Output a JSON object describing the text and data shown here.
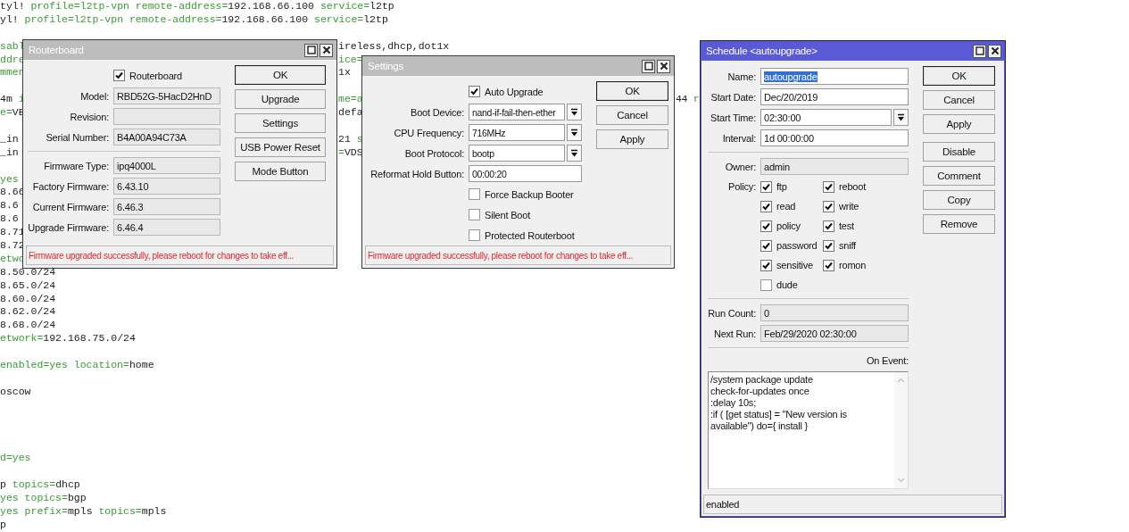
{
  "console": {
    "lines": [
      {
        "left": [
          {
            "text": "tyl! ",
            "kind": "value"
          },
          {
            "text": "profile=l2tp-vpn remote-address=",
            "kind": "key"
          },
          {
            "text": "192.168.66.100 ",
            "kind": "value"
          },
          {
            "text": "service=",
            "kind": "key"
          },
          {
            "text": "l2tp",
            "kind": "value"
          }
        ]
      },
      {
        "left": [
          {
            "text": "yl! ",
            "kind": "value"
          },
          {
            "text": "profile=l2tp-vpn remote-address=",
            "kind": "key"
          },
          {
            "text": "192.168.66.100 ",
            "kind": "value"
          },
          {
            "text": "service=",
            "kind": "key"
          },
          {
            "text": "l2tp",
            "kind": "value"
          }
        ]
      },
      {
        "kind": "spaced",
        "left": [
          {
            "text": "sabl",
            "kind": "key"
          }
        ],
        "middle": [
          {
            "text": "ireless,dhcp,dot1x",
            "kind": "value"
          }
        ]
      },
      {
        "left": [
          {
            "text": "ddre",
            "kind": "key"
          }
        ],
        "middle": [
          {
            "text": "ice=",
            "kind": "key"
          }
        ]
      },
      {
        "left": [
          {
            "text": "mmen",
            "kind": "key"
          }
        ],
        "middle": [
          {
            "text": "1x",
            "kind": "value"
          }
        ]
      },
      {
        "kind": "spaced",
        "left": [
          {
            "text": "4m ",
            "kind": "value"
          },
          {
            "text": "i",
            "kind": "key"
          }
        ],
        "middle": [
          {
            "text": "me=a",
            "kind": "key"
          }
        ],
        "right": [
          {
            "text": "44 ",
            "kind": "value"
          },
          {
            "text": "r",
            "kind": "key"
          }
        ]
      },
      {
        "left": [
          {
            "text": "e=",
            "kind": "key"
          },
          {
            "text": "VE",
            "kind": "value"
          }
        ],
        "middle": [
          {
            "text": "defa",
            "kind": "value"
          }
        ]
      },
      {
        "kind": "spaced",
        "left": [
          {
            "text": "_in",
            "kind": "value"
          }
        ],
        "middle": [
          {
            "text": "21 ",
            "kind": "value"
          },
          {
            "text": "s",
            "kind": "key"
          }
        ]
      },
      {
        "left": [
          {
            "text": "_in",
            "kind": "value"
          }
        ],
        "middle": [
          {
            "text": "=",
            "kind": "key"
          },
          {
            "text": "VDS",
            "kind": "value"
          }
        ]
      },
      {
        "kind": "spaced",
        "left": [
          {
            "text": "yes",
            "kind": "key"
          }
        ]
      },
      {
        "left": [
          {
            "text": "8.66",
            "kind": "value"
          }
        ]
      },
      {
        "left": [
          {
            "text": "8.6",
            "kind": "value"
          }
        ]
      },
      {
        "left": [
          {
            "text": "8.6",
            "kind": "value"
          }
        ]
      },
      {
        "left": [
          {
            "text": "8.71",
            "kind": "value"
          }
        ]
      },
      {
        "left": [
          {
            "text": "8.72",
            "kind": "value"
          }
        ]
      },
      {
        "left": [
          {
            "text": "etwo",
            "kind": "key"
          }
        ]
      },
      {
        "left": [
          {
            "text": "8.50.0/24",
            "kind": "value"
          }
        ]
      },
      {
        "left": [
          {
            "text": "8.65.0/24",
            "kind": "value"
          }
        ]
      },
      {
        "left": [
          {
            "text": "8.60.0/24",
            "kind": "value"
          }
        ]
      },
      {
        "left": [
          {
            "text": "8.62.0/24",
            "kind": "value"
          }
        ]
      },
      {
        "left": [
          {
            "text": "8.68.0/24",
            "kind": "value"
          }
        ]
      },
      {
        "left": [
          {
            "text": "etwork=",
            "kind": "key"
          },
          {
            "text": "192.168.75.0/24",
            "kind": "value"
          }
        ]
      },
      {
        "kind": "spaced",
        "left": [
          {
            "text": "enabled=yes location=",
            "kind": "key"
          },
          {
            "text": "home",
            "kind": "value"
          }
        ]
      },
      {
        "kind": "spaced",
        "left": [
          {
            "text": "oscow",
            "kind": "value"
          }
        ]
      },
      {
        "kind": "gapped",
        "left": [
          {
            "text": "d=yes",
            "kind": "key"
          }
        ]
      },
      {
        "kind": "spaced",
        "left": [
          {
            "text": "p ",
            "kind": "value"
          },
          {
            "text": "topics=",
            "kind": "key"
          },
          {
            "text": "dhcp",
            "kind": "value"
          }
        ]
      },
      {
        "left": [
          {
            "text": "yes topics=",
            "kind": "key"
          },
          {
            "text": "bgp",
            "kind": "value"
          }
        ]
      },
      {
        "left": [
          {
            "text": "yes prefix=",
            "kind": "key"
          },
          {
            "text": "mpls ",
            "kind": "value"
          },
          {
            "text": "topics=",
            "kind": "key"
          },
          {
            "text": "mpls",
            "kind": "value"
          }
        ]
      },
      {
        "left": [
          {
            "text": "p",
            "kind": "value"
          }
        ]
      }
    ]
  },
  "windows": [
    {
      "kind": "routerboard",
      "title": "Routerboard",
      "active": false,
      "rows": [
        {
          "kind": "checkbox",
          "label": "Routerboard",
          "checked": true
        },
        {
          "kind": "field",
          "label": "Model:",
          "value": "RBD52G-5HacD2HnD",
          "editable": false
        },
        {
          "kind": "field",
          "label": "Revision:",
          "editable": false
        },
        {
          "kind": "field",
          "label": "Serial Number:",
          "value": "B4A00A94C73A",
          "editable": false
        },
        {
          "kind": "separator"
        },
        {
          "kind": "field",
          "label": "Firmware Type:",
          "value": "ipq4000L",
          "editable": false
        },
        {
          "kind": "field",
          "label": "Factory Firmware:",
          "value": "6.43.10",
          "editable": false
        },
        {
          "kind": "field",
          "label": "Current Firmware:",
          "value": "6.46.3",
          "editable": false
        },
        {
          "kind": "field",
          "label": "Upgrade Firmware:",
          "value": "6.46.4",
          "editable": false
        }
      ],
      "buttons": [
        {
          "label": "OK",
          "default": true
        },
        {
          "label": "Upgrade"
        },
        {
          "label": "Settings"
        },
        {
          "label": "USB Power Reset"
        },
        {
          "label": "Mode Button"
        }
      ],
      "status": "Firmware upgraded successfully, please reboot for changes to take eff...",
      "status_error": true
    },
    {
      "kind": "settings",
      "title": "Settings",
      "active": false,
      "rows": [
        {
          "kind": "checkbox",
          "label": "Auto Upgrade",
          "checked": true
        },
        {
          "kind": "field",
          "label": "Boot Device:",
          "value": "nand-if-fail-then-ether",
          "editable": true,
          "dropdown": true
        },
        {
          "kind": "field",
          "label": "CPU Frequency:",
          "value": "716MHz",
          "editable": true,
          "dropdown": true
        },
        {
          "kind": "field",
          "label": "Boot Protocol:",
          "value": "bootp",
          "editable": true,
          "dropdown": true
        },
        {
          "kind": "field",
          "label": "Reformat Hold Button:",
          "value": "00:00:20",
          "editable": true
        },
        {
          "kind": "checkbox",
          "label": "Force Backup Booter",
          "checked": false
        },
        {
          "kind": "checkbox",
          "label": "Silent Boot",
          "checked": false
        },
        {
          "kind": "checkbox",
          "label": "Protected Routerboot",
          "checked": false
        }
      ],
      "buttons": [
        {
          "label": "OK",
          "default": true
        },
        {
          "label": "Cancel"
        },
        {
          "label": "Apply"
        }
      ],
      "status": "Firmware upgraded successfully, please reboot for changes to take eff...",
      "status_error": true
    },
    {
      "kind": "schedule",
      "title": "Schedule <autoupgrade>",
      "active": true,
      "rows": [
        {
          "kind": "field",
          "label": "Name:",
          "value": "autoupgrade",
          "editable": true,
          "text_selected": true
        },
        {
          "kind": "field",
          "label": "Start Date:",
          "value": "Dec/20/2019",
          "editable": true
        },
        {
          "kind": "field",
          "label": "Start Time:",
          "value": "02:30:00",
          "editable": true,
          "dropdown": true
        },
        {
          "kind": "field",
          "label": "Interval:",
          "value": "1d 00:00:00",
          "editable": true
        },
        {
          "kind": "separator"
        },
        {
          "kind": "field",
          "label": "Owner:",
          "value": "admin",
          "editable": false
        },
        {
          "kind": "checkgrid",
          "label": "Policy:",
          "items": [
            {
              "label": "ftp",
              "checked": true
            },
            {
              "label": "reboot",
              "checked": true
            },
            {
              "label": "read",
              "checked": true
            },
            {
              "label": "write",
              "checked": true
            },
            {
              "label": "policy",
              "checked": true
            },
            {
              "label": "test",
              "checked": true
            },
            {
              "label": "password",
              "checked": true
            },
            {
              "label": "sniff",
              "checked": true
            },
            {
              "label": "sensitive",
              "checked": true
            },
            {
              "label": "romon",
              "checked": true
            },
            {
              "label": "dude",
              "checked": false
            }
          ]
        },
        {
          "kind": "separator"
        },
        {
          "kind": "field",
          "label": "Run Count:",
          "value": "0",
          "editable": false
        },
        {
          "kind": "field",
          "label": "Next Run:",
          "value": "Feb/29/2020 02:30:00",
          "editable": false
        },
        {
          "kind": "separator"
        },
        {
          "kind": "caption",
          "label": "On Event:"
        },
        {
          "kind": "textarea",
          "value": "/system package update\ncheck-for-updates once\n:delay 10s;\n:if ( [get status] = \"New version is\navailable\") do={ install }"
        }
      ],
      "buttons": [
        {
          "label": "OK",
          "default": true
        },
        {
          "label": "Cancel"
        },
        {
          "label": "Apply"
        },
        {
          "label": "Disable",
          "gap_before": true
        },
        {
          "label": "Comment"
        },
        {
          "label": "Copy"
        },
        {
          "label": "Remove"
        }
      ],
      "status": "enabled",
      "status_error": false
    }
  ]
}
